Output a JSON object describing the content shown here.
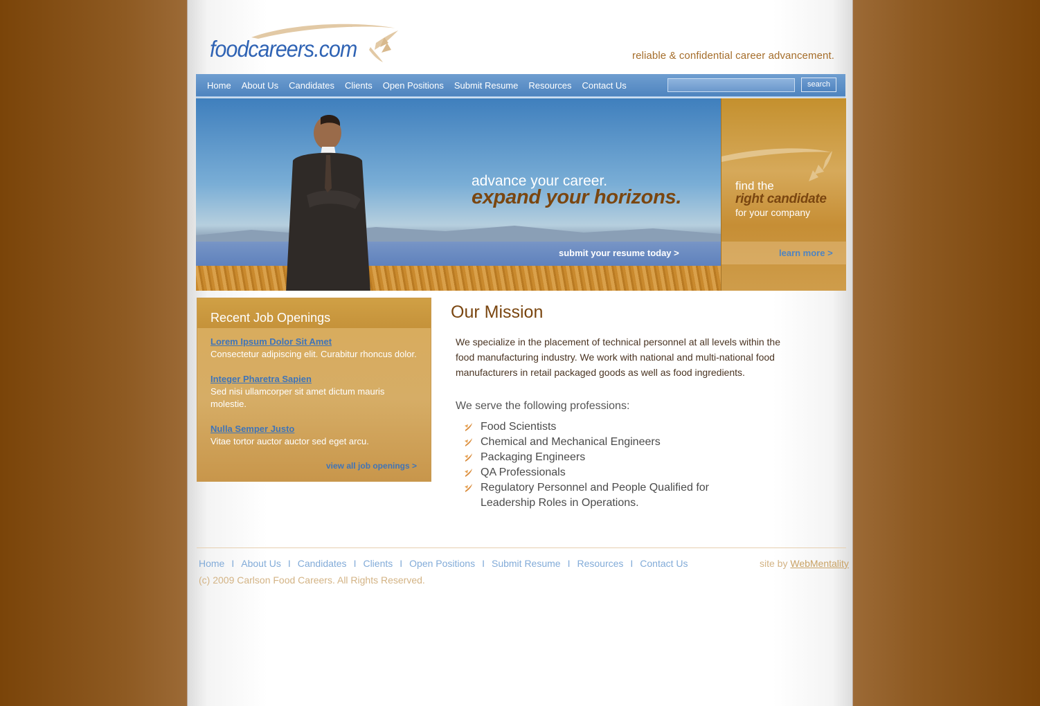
{
  "brand": {
    "logo_text": "foodcareers.com",
    "tagline": "reliable & confidential career advancement."
  },
  "nav": {
    "items": [
      "Home",
      "About Us",
      "Candidates",
      "Clients",
      "Open Positions",
      "Submit Resume",
      "Resources",
      "Contact Us"
    ],
    "search_placeholder": "",
    "search_label": "search"
  },
  "hero": {
    "line1": "advance your career.",
    "line2": "expand your horizons.",
    "cta": "submit your resume today >"
  },
  "promo": {
    "line1": "find the",
    "line2": "right candidate",
    "line3": "for your company",
    "cta": "learn more >"
  },
  "jobs": {
    "title": "Recent Job Openings",
    "items": [
      {
        "title": "Lorem Ipsum Dolor Sit Amet",
        "desc": "Consectetur adipiscing elit. Curabitur rhoncus dolor."
      },
      {
        "title": "Integer Pharetra Sapien",
        "desc": "Sed nisi ullamcorper sit amet dictum mauris molestie."
      },
      {
        "title": "Nulla Semper Justo",
        "desc": "Vitae tortor auctor auctor sed eget arcu."
      }
    ],
    "cta": "view all job openings >"
  },
  "mission": {
    "title": "Our Mission",
    "text": "We specialize in the placement of technical personnel at all levels within the food manufacturing industry.  We work with national and multi-national food manufacturers in retail packaged goods as well as food ingredients.",
    "serve": "We serve the following professions:",
    "professions": [
      "Food Scientists",
      "Chemical and Mechanical Engineers",
      "Packaging Engineers",
      "QA Professionals",
      "Regulatory Personnel and People Qualified for Leadership Roles in Operations."
    ]
  },
  "footer": {
    "nav": [
      "Home",
      "About Us",
      "Candidates",
      "Clients",
      "Open Positions",
      "Submit Resume",
      "Resources",
      "Contact Us"
    ],
    "separator": "I",
    "credit_prefix": "site by",
    "credit_link": "WebMentality",
    "copyright": "(c) 2009 Carlson Food Careers. All Rights Reserved."
  },
  "colors": {
    "nav_blue": "#4e84bf",
    "brand_brown": "#7a4610",
    "gold": "#d6a95a",
    "link_blue": "#3f74b8"
  }
}
